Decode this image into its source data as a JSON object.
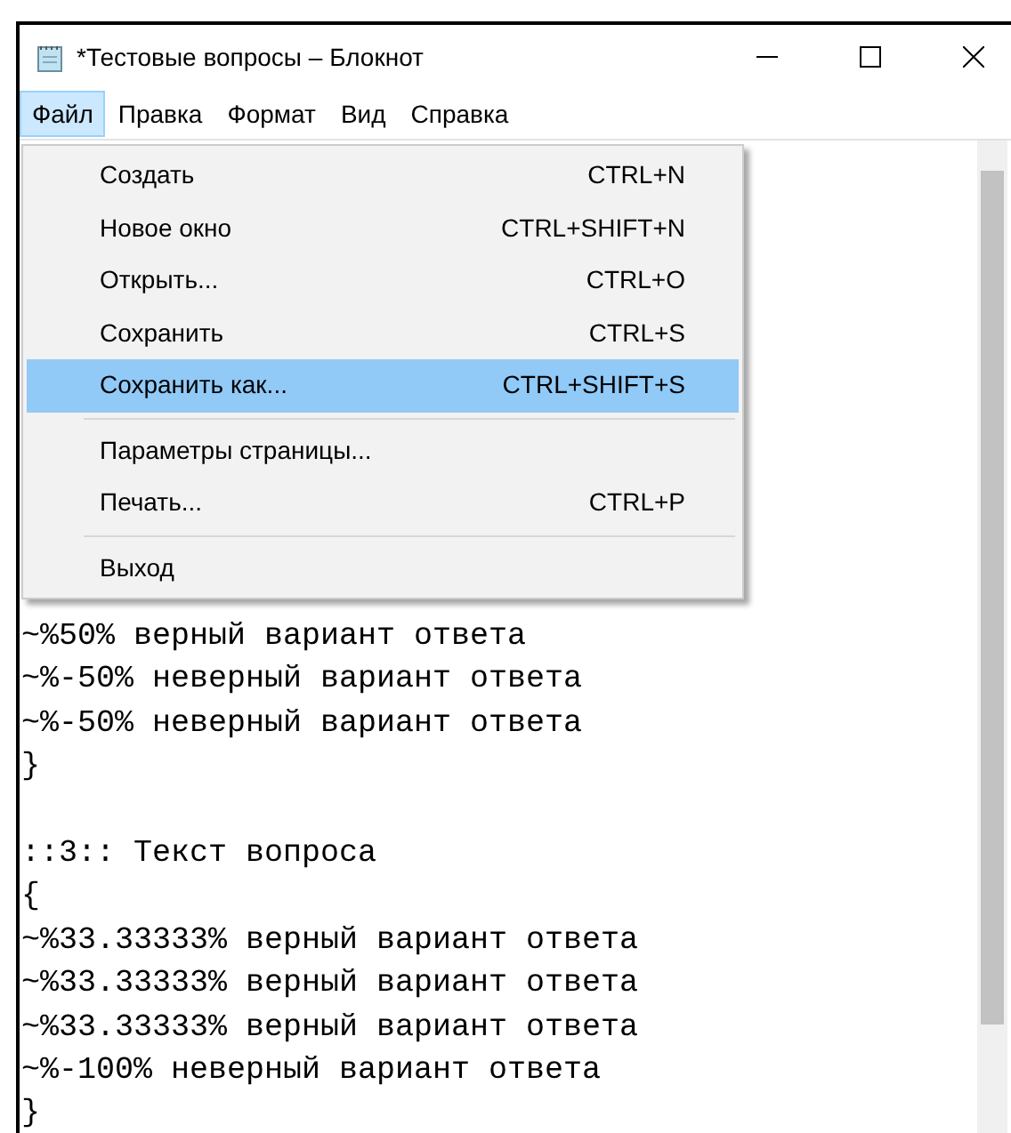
{
  "window": {
    "title": "*Тестовые вопросы – Блокнот"
  },
  "menu_bar": [
    {
      "label": "Файл",
      "selected": true
    },
    {
      "label": "Правка",
      "selected": false
    },
    {
      "label": "Формат",
      "selected": false
    },
    {
      "label": "Вид",
      "selected": false
    },
    {
      "label": "Справка",
      "selected": false
    }
  ],
  "file_menu": {
    "items": [
      {
        "kind": "item",
        "label": "Создать",
        "shortcut": "CTRL+N",
        "selected": false
      },
      {
        "kind": "item",
        "label": "Новое окно",
        "shortcut": "CTRL+SHIFT+N",
        "selected": false
      },
      {
        "kind": "item",
        "label": "Открыть...",
        "shortcut": "CTRL+O",
        "selected": false
      },
      {
        "kind": "item",
        "label": "Сохранить",
        "shortcut": "CTRL+S",
        "selected": false
      },
      {
        "kind": "item",
        "label": "Сохранить как...",
        "shortcut": "CTRL+SHIFT+S",
        "selected": true
      },
      {
        "kind": "separator"
      },
      {
        "kind": "item",
        "label": "Параметры страницы...",
        "selected": false
      },
      {
        "kind": "item",
        "label": "Печать...",
        "shortcut": "CTRL+P",
        "selected": false
      },
      {
        "kind": "separator"
      },
      {
        "kind": "item",
        "label": "Выход",
        "selected": false
      }
    ]
  },
  "editor": {
    "lines": [
      {
        "kind": "text",
        "text": "~%50% верный вариант ответа"
      },
      {
        "kind": "text",
        "text": "~%-50% неверный вариант ответа"
      },
      {
        "kind": "text",
        "text": "~%-50% неверный вариант ответа"
      },
      {
        "kind": "text",
        "text": "}"
      },
      {
        "kind": "blank"
      },
      {
        "kind": "text",
        "text": "::3:: Текст вопроса"
      },
      {
        "kind": "text",
        "text": "{"
      },
      {
        "kind": "text",
        "text": "~%33.33333% верный вариант ответа"
      },
      {
        "kind": "text",
        "text": "~%33.33333% верный вариант ответа"
      },
      {
        "kind": "text",
        "text": "~%33.33333% верный вариант ответа"
      },
      {
        "kind": "text",
        "text": "~%-100% неверный вариант ответа"
      },
      {
        "kind": "text",
        "text": "}"
      }
    ]
  }
}
